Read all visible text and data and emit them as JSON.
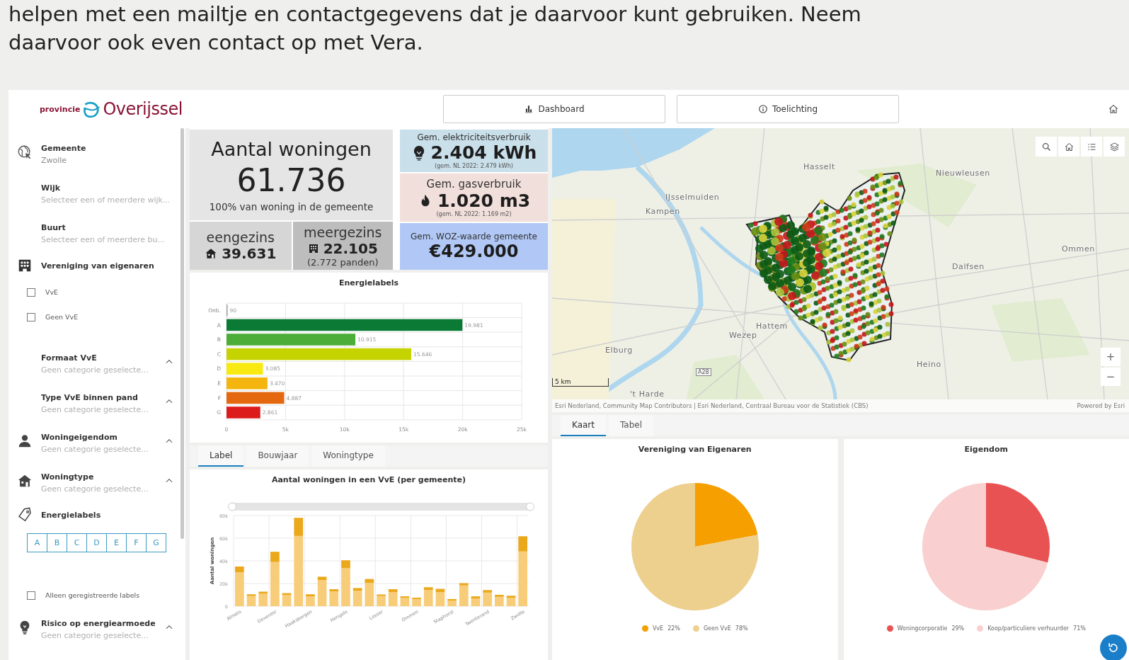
{
  "intro": {
    "lines": [
      "helpen met een mailtje en contactgegevens dat je daarvoor kunt gebruiken. Neem",
      "daarvoor ook even contact op met Vera."
    ]
  },
  "header": {
    "logo_small": "provincie",
    "logo_name": "Overijssel",
    "buttons": [
      "Dashboard",
      "Toelichting"
    ]
  },
  "sidebar": {
    "items": [
      {
        "kind": "select",
        "label": "Gemeente",
        "value": "Zwolle"
      },
      {
        "kind": "select",
        "label": "Wijk",
        "placeholder": "Selecteer een of meerdere wijk..."
      },
      {
        "kind": "select",
        "label": "Buurt",
        "placeholder": "Selecteer een of meerdere bu..."
      },
      {
        "kind": "heading",
        "label": "Vereniging van eigenaren"
      },
      {
        "kind": "checkbox",
        "label": "VvE",
        "checked": false
      },
      {
        "kind": "checkbox",
        "label": "Geen VvE",
        "checked": false
      },
      {
        "kind": "dropdown",
        "label": "Formaat VvE",
        "placeholder": "Geen categorie geselecte..."
      },
      {
        "kind": "dropdown",
        "label": "Type VvE binnen pand",
        "placeholder": "Geen categorie geselecte..."
      },
      {
        "kind": "dropdown",
        "label": "Woningeigendom",
        "placeholder": "Geen categorie geselecte..."
      },
      {
        "kind": "dropdown",
        "label": "Woningtype",
        "placeholder": "Geen categorie geselecte..."
      },
      {
        "kind": "heading",
        "label": "Energielabels"
      },
      {
        "kind": "labels",
        "labels": [
          "A",
          "B",
          "C",
          "D",
          "E",
          "F",
          "G"
        ]
      },
      {
        "kind": "checkbox",
        "label": "Alleen geregistreerde labels",
        "checked": false
      },
      {
        "kind": "dropdown",
        "label": "Risico op energiearmoede",
        "placeholder": "Geen categorie geselecte..."
      }
    ]
  },
  "stats": {
    "total": {
      "title": "Aantal woningen",
      "value": "61.736",
      "note": "100% van woning in de gemeente"
    },
    "eengezins": {
      "label": "eengezins",
      "value": "39.631"
    },
    "meergezins": {
      "label": "meergezins",
      "value": "22.105",
      "note": "(2.772 panden)"
    },
    "cards": [
      {
        "kind": "elec",
        "title": "Gem. elektriciteitsverbruik",
        "value": "2.404 kWh",
        "note": "(gem. NL 2022: 2.479 kWh)"
      },
      {
        "kind": "gas",
        "title": "Gem. gasverbruik",
        "value": "1.020 m3",
        "note": "(gem. NL 2022: 1.169 m2)"
      },
      {
        "kind": "woz",
        "title": "Gem. WOZ-waarde gemeente",
        "value": "€429.000"
      }
    ]
  },
  "energielabels": {
    "title": "Energielabels",
    "chart_data": {
      "type": "bar",
      "orientation": "horizontal",
      "stacked": true,
      "grid": true,
      "categories": [
        "Onb.",
        "A",
        "B",
        "C",
        "D",
        "E",
        "F",
        "G"
      ],
      "series": [
        {
          "color": "#9e9e9e",
          "values": [
            90,
            null,
            null,
            null,
            null,
            null,
            null,
            null
          ]
        },
        {
          "color": "#0b7a35",
          "values": [
            null,
            19981,
            null,
            null,
            null,
            null,
            null,
            null
          ]
        },
        {
          "color": "#4cae38",
          "values": [
            null,
            null,
            10915,
            null,
            null,
            null,
            null,
            null
          ]
        },
        {
          "color": "#c5d300",
          "values": [
            null,
            null,
            null,
            15646,
            null,
            null,
            null,
            null
          ]
        },
        {
          "color": "#f8ea10",
          "values": [
            null,
            null,
            null,
            null,
            3085,
            null,
            null,
            null
          ]
        },
        {
          "color": "#f4b50f",
          "values": [
            null,
            null,
            null,
            null,
            null,
            3470,
            null,
            null
          ]
        },
        {
          "color": "#e4680f",
          "values": [
            null,
            null,
            null,
            null,
            null,
            null,
            4887,
            null
          ]
        },
        {
          "color": "#dc1c1c",
          "values": [
            null,
            null,
            null,
            null,
            null,
            null,
            null,
            2861
          ]
        }
      ],
      "value_labels": [
        "90",
        "19.981",
        "10.915",
        "15.646",
        "3.085",
        "3.470",
        "4.887",
        "2.861"
      ],
      "xlim": [
        0,
        25000
      ],
      "xticks": [
        {
          "value": 0,
          "label": "0"
        },
        {
          "value": 5000,
          "label": "5k"
        },
        {
          "value": 10000,
          "label": "10k"
        },
        {
          "value": 15000,
          "label": "15k"
        },
        {
          "value": 20000,
          "label": "20k"
        },
        {
          "value": 25000,
          "label": "25k"
        }
      ]
    }
  },
  "chart_tabs": [
    {
      "label": "Label",
      "selected": true
    },
    {
      "label": "Bouwjaar",
      "selected": false
    },
    {
      "label": "Woningtype",
      "selected": false
    }
  ],
  "vve_chart": {
    "title": "Aantal woningen in een VvE (per gemeente)",
    "chart_data": {
      "type": "bar",
      "stacked": true,
      "grid": true,
      "ylabel": "Aantal woningen",
      "categories": [
        "Almelo",
        null,
        null,
        "Deventer",
        null,
        null,
        "Haaksbergen",
        null,
        null,
        "Hengelo",
        null,
        null,
        "Losser",
        null,
        null,
        "Ommen",
        null,
        null,
        "Staphorst",
        null,
        null,
        "Twenterand",
        null,
        null,
        "Zwolle"
      ],
      "ylim": [
        0,
        80000
      ],
      "yticks": [
        {
          "value": 0,
          "label": "0"
        },
        {
          "value": 20000,
          "label": "20k"
        },
        {
          "value": 40000,
          "label": "40k"
        },
        {
          "value": 60000,
          "label": "60k"
        },
        {
          "value": 80000,
          "label": "80k"
        }
      ],
      "series": [
        {
          "color": "#f7cd7a",
          "values": [
            30000,
            9000,
            11000,
            39000,
            10000,
            62000,
            8700,
            23000,
            13000,
            33500,
            13500,
            20500,
            9000,
            12500,
            7500,
            6300,
            14200,
            12500,
            5000,
            18300,
            6700,
            12000,
            8300,
            7500,
            48300
          ]
        },
        {
          "color": "#eba81a",
          "values": [
            5000,
            1500,
            1800,
            9000,
            1500,
            16000,
            1800,
            3000,
            2000,
            7000,
            2500,
            3500,
            1300,
            2500,
            1200,
            1200,
            2500,
            2800,
            1300,
            2000,
            2000,
            2200,
            1700,
            1700,
            13400
          ]
        }
      ]
    }
  },
  "map": {
    "places": [
      "Hasselt",
      "Nieuwleusen",
      "IJsselmuiden",
      "Kampen",
      "Ommen",
      "Dalfsen",
      "Hattem",
      "Wezep",
      "Elburg",
      "Heino",
      "'t Harde"
    ],
    "road": "A28",
    "scale": "5 km",
    "zoom_buttons": [
      "+",
      "−"
    ],
    "attribution": "Esri Nederland, Community Map Contributors | Esri Nederland, Centraal Bureau voor de Statistiek (CBS)",
    "powered": "Powered by Esri"
  },
  "map_tabs": [
    {
      "label": "Kaart",
      "selected": true
    },
    {
      "label": "Tabel",
      "selected": false
    }
  ],
  "pies": [
    {
      "title": "Vereniging van Eigenaren",
      "legend": [
        {
          "label": "VvE",
          "value": "22%",
          "color": "#f59f00"
        },
        {
          "label": "Geen VvE",
          "value": "78%",
          "color": "#edcf8e"
        }
      ],
      "chart_data": {
        "type": "pie",
        "values": [
          22,
          78
        ]
      }
    },
    {
      "title": "Eigendom",
      "legend": [
        {
          "label": "Woningcorporatie",
          "value": "29%",
          "color": "#e85252"
        },
        {
          "label": "Koop/particuliere verhuurder",
          "value": "71%",
          "color": "#f9cfcf"
        }
      ],
      "chart_data": {
        "type": "pie",
        "values": [
          29,
          71
        ]
      }
    }
  ]
}
